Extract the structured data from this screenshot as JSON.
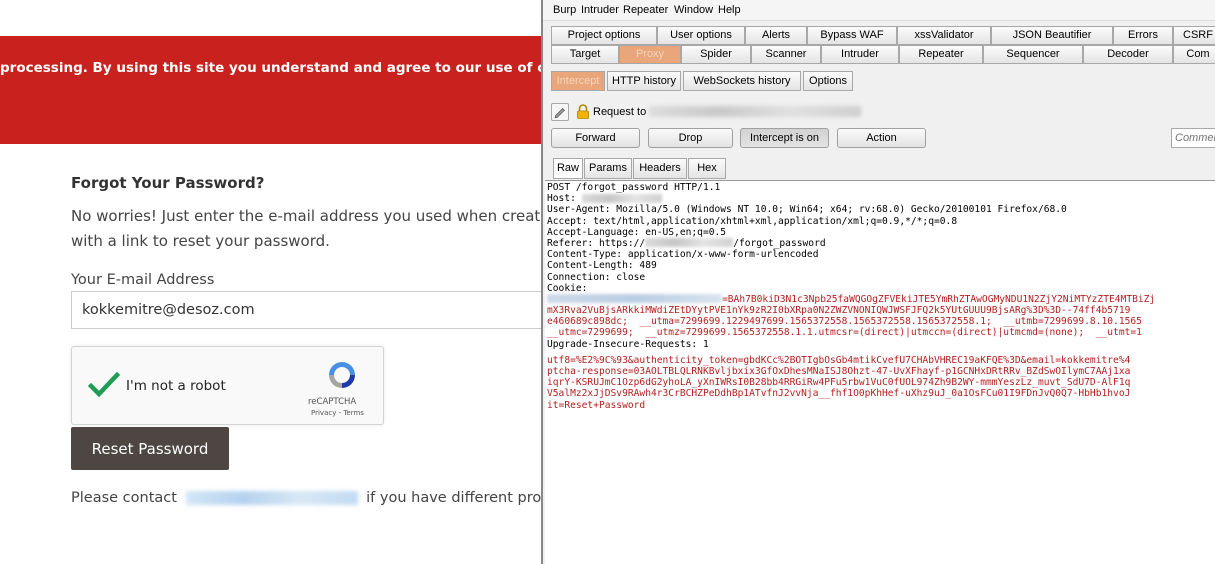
{
  "site": {
    "cookie_banner": "processing. By using this site you understand and agree to our use of cookies, our",
    "title": "Forgot Your Password?",
    "desc_line1": "No worries! Just enter the e-mail address you used when creating y",
    "desc_line2": "with a link to reset your password.",
    "email_label": "Your E-mail Address",
    "email_value": "kokkemitre@desoz.com",
    "recaptcha_label": "I'm not a robot",
    "recaptcha_brand": "reCAPTCHA",
    "recaptcha_terms": "Privacy - Terms",
    "reset_button": "Reset Password",
    "contact_prefix": "Please contact",
    "contact_suffix": "if you have different probler"
  },
  "burp": {
    "menu": [
      "Burp",
      "Intruder",
      "Repeater",
      "Window",
      "Help"
    ],
    "tabs_row1": [
      "Project options",
      "User options",
      "Alerts",
      "Bypass WAF",
      "xssValidator",
      "JSON Beautifier",
      "Errors",
      "CSRF"
    ],
    "tabs_row2": [
      "Target",
      "Proxy",
      "Spider",
      "Scanner",
      "Intruder",
      "Repeater",
      "Sequencer",
      "Decoder",
      "Com"
    ],
    "subtabs": [
      "Intercept",
      "HTTP history",
      "WebSockets history",
      "Options"
    ],
    "request_label": "Request to",
    "buttons": {
      "forward": "Forward",
      "drop": "Drop",
      "intercept": "Intercept is on",
      "action": "Action"
    },
    "comment_placeholder": "Commen",
    "view_tabs": [
      "Raw",
      "Params",
      "Headers",
      "Hex"
    ],
    "request_lines": {
      "l1": "POST /forgot_password HTTP/1.1",
      "l2": "Host:",
      "l3": "User-Agent: Mozilla/5.0 (Windows NT 10.0; Win64; x64; rv:68.0) Gecko/20100101 Firefox/68.0",
      "l4": "Accept: text/html,application/xhtml+xml,application/xml;q=0.9,*/*;q=0.8",
      "l5": "Accept-Language: en-US,en;q=0.5",
      "l6a": "Referer: https://",
      "l6b": "/forgot_password",
      "l7": "Content-Type: application/x-www-form-urlencoded",
      "l8": "Content-Length: 489",
      "l9": "Connection: close",
      "l10": "Cookie:",
      "c1": "=BAh7B0kiD3N1c3Npb25faWQGOgZFVEkiJTE5YmRhZTAwOGMyNDU1N2ZjY2NiMTYzZTE4MTBiZj",
      "c2": "mX3Rva2VuBjsARkkiMWdiZEtDYytPVE1nYk9zR2I0bXRpa0N2ZWZVNONIQWJWSFJFQ2k5YUtGUUU9BjsARg%3D%3D--74ff4b5719",
      "c3": "e460689c898dc;  __utma=7299699.1229497699.1565372558.1565372558.1565372558.1;  __utmb=7299699.8.10.1565",
      "c4": "__utmc=7299699;  __utmz=7299699.1565372558.1.1.utmcsr=(direct)|utmccn=(direct)|utmcmd=(none);  __utmt=1",
      "l11": "Upgrade-Insecure-Requests: 1",
      "b1": "utf8=%E2%9C%93&authenticity_token=gbdKCc%2BOTIgbOsGb4mtikCvefU7CHAbVHREC19aKFQE%3D&email=kokkemitre%4",
      "b2": "ptcha-response=03AOLTBLQLRNKBvljbxix3GfOxDhesMNaISJ8Ohzt-47-UvXFhayf-p1GCNHxDRtRRv_BZdSwOIlymC7AAj1xa",
      "b3": "iqrY-KSRUJmC1Ozp6dG2yhoLA_yXnIWRsI0B28bb4RRGiRw4PFu5rbw1VuC0fUOL974Zh9B2WY-mmmYeszLz_muvt_SdU7D-AlF1q",
      "b4": "V5alMz2xJjDSv9RAwh4r3CrBCHZPeDdhBp1ATvfnJ2vvNja__fhf1O0pKhHef-uXhz9uJ_0a1OsFCu01I9FDnJvQ0Q7-HbHb1hvoJ",
      "b5": "it=Reset+Password"
    }
  },
  "colors": {
    "banner_red": "#c9211e",
    "button_dark": "#4d4642",
    "proxy_tab_orange": "#e8a67a",
    "body_param_red": "#b41f1f"
  }
}
